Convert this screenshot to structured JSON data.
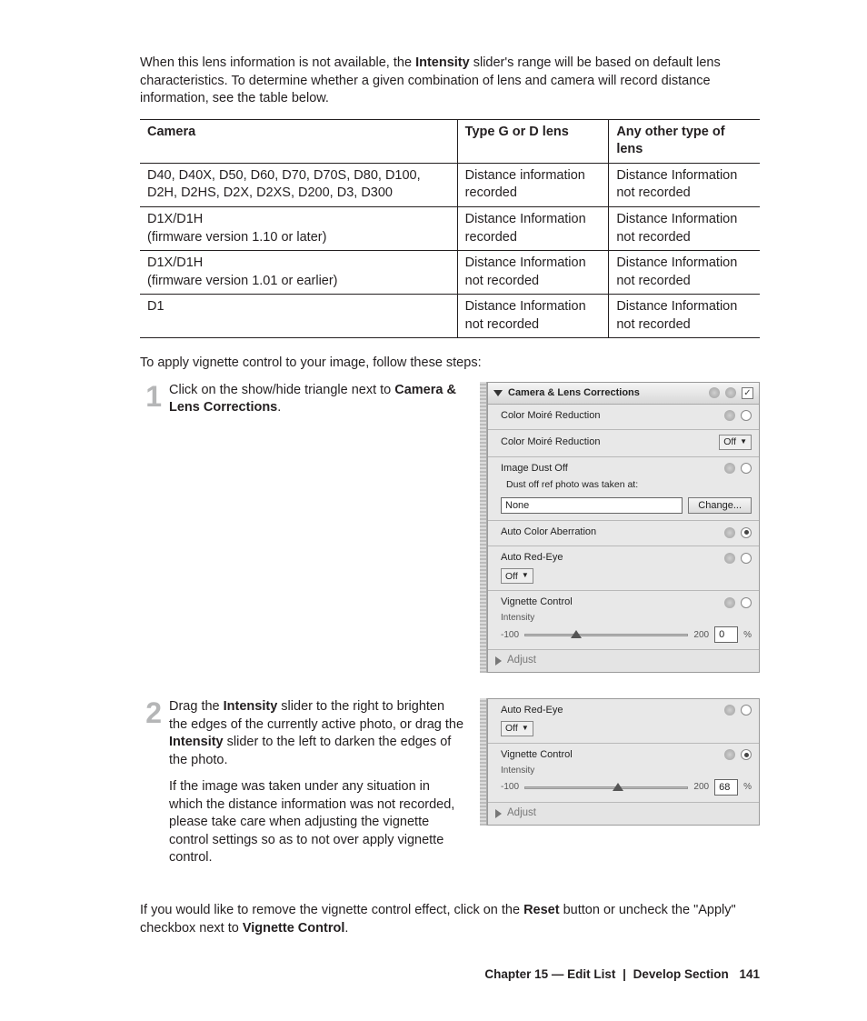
{
  "intro": {
    "t1": "When this lens information is not available, the ",
    "b1": "Intensity",
    "t2": " slider's range will be based on default lens characteristics. To determine whether a given combination of lens and camera will record distance information, see the table below."
  },
  "table": {
    "headers": [
      "Camera",
      "Type G or D lens",
      "Any other type of lens"
    ],
    "rows": [
      [
        "D40, D40X, D50, D60, D70, D70S, D80, D100, D2H, D2HS, D2X, D2XS, D200, D3, D300",
        "Distance information recorded",
        "Distance Information not recorded"
      ],
      [
        "D1X/D1H\n(firmware version 1.10 or later)",
        "Distance Information recorded",
        "Distance Information not recorded"
      ],
      [
        "D1X/D1H\n(firmware version 1.01 or earlier)",
        "Distance Information not recorded",
        "Distance Information not recorded"
      ],
      [
        "D1",
        "Distance Information not recorded",
        "Distance Information not recorded"
      ]
    ]
  },
  "follow": "To apply vignette control to your image, follow these steps:",
  "steps": {
    "s1": {
      "num": "1",
      "pre": "Click on the show/hide triangle next to ",
      "bold": "Camera & Lens Corrections",
      "post": "."
    },
    "s2": {
      "num": "2",
      "t1a": "Drag the ",
      "t1b": "Intensity",
      "t1c": " slider to the right to brighten the edges of the currently active photo, or drag the ",
      "t1d": "Intensity",
      "t1e": " slider to the left to darken the edges of the photo.",
      "t2": "If the image was taken under any situation in which the distance information was not recorded, please take care when adjusting the vignette control settings so as to not over apply vignette control."
    }
  },
  "panel1": {
    "title": "Camera & Lens Corrections",
    "color_moire": "Color Moiré Reduction",
    "color_moire2": "Color Moiré Reduction",
    "off": "Off",
    "dust": "Image Dust Off",
    "dust_sub": "Dust off ref photo was taken at:",
    "none": "None",
    "change": "Change...",
    "aca": "Auto Color Aberration",
    "redeye": "Auto Red-Eye",
    "vig": "Vignette Control",
    "intensity": "Intensity",
    "min": "-100",
    "max": "200",
    "val": "0",
    "pct": "%",
    "adjust": "Adjust"
  },
  "panel2": {
    "redeye": "Auto Red-Eye",
    "off": "Off",
    "vig": "Vignette Control",
    "intensity": "Intensity",
    "min": "-100",
    "max": "200",
    "val": "68",
    "pct": "%",
    "adjust": "Adjust"
  },
  "closing": {
    "t1": "If you would like to remove the vignette control effect, click on the ",
    "b1": "Reset",
    "t2": " button or uncheck the \"Apply\" checkbox next to ",
    "b2": "Vignette Control",
    "t3": "."
  },
  "footer": {
    "chapter": "Chapter 15 — Edit List",
    "section": "Develop Section",
    "page": "141"
  }
}
